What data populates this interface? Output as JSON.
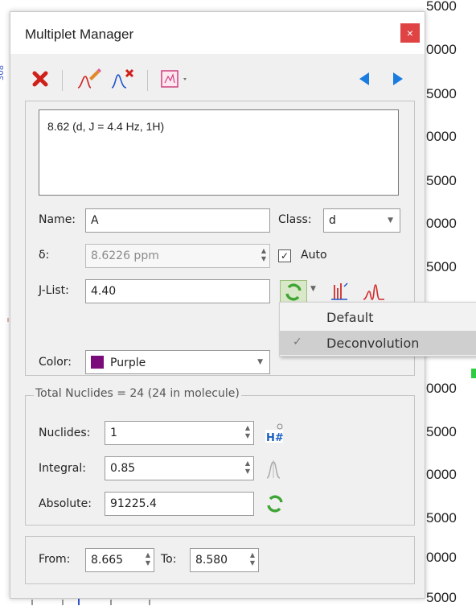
{
  "dialog": {
    "title": "Multiplet Manager",
    "close_glyph": "×"
  },
  "multiplet_text": "8.62 (d, J = 4.4 Hz, 1H)",
  "fields": {
    "name_label": "Name:",
    "name_value": "A",
    "class_label": "Class:",
    "class_value": "d",
    "delta_label": "δ:",
    "delta_value": "8.6226 ppm",
    "auto_label": "Auto",
    "auto_checked": true,
    "jlist_label": "J-List:",
    "jlist_value": "4.40",
    "color_label": "Color:",
    "color_value": "Purple",
    "color_hex": "#7b0a7b"
  },
  "nuclides_group": {
    "legend": "Total Nuclides = 24 (24 in molecule)",
    "nuclides_label": "Nuclides:",
    "nuclides_value": "1",
    "integral_label": "Integral:",
    "integral_value": "0.85",
    "absolute_label": "Absolute:",
    "absolute_value": "91225.4"
  },
  "range": {
    "from_label": "From:",
    "from_value": "8.665",
    "to_label": "To:",
    "to_value": "8.580"
  },
  "popup": {
    "items": [
      {
        "label": "Default",
        "selected": false
      },
      {
        "label": "Deconvolution",
        "selected": true
      }
    ],
    "check_glyph": "✓"
  },
  "axis_ticks": [
    "5000",
    "0000",
    "5000",
    "0000",
    "5000",
    "0000",
    "5000",
    "",
    "",
    "0000",
    "5000",
    "0000",
    "5000",
    "0000",
    "5000",
    "0000"
  ],
  "icons": {
    "delete": "delete-x-icon",
    "pencil_multiplet": "edit-multiplet-icon",
    "delete_multiplet": "delete-multiplet-icon",
    "report": "report-icon",
    "prev": "prev-arrow-icon",
    "next": "next-arrow-icon"
  }
}
